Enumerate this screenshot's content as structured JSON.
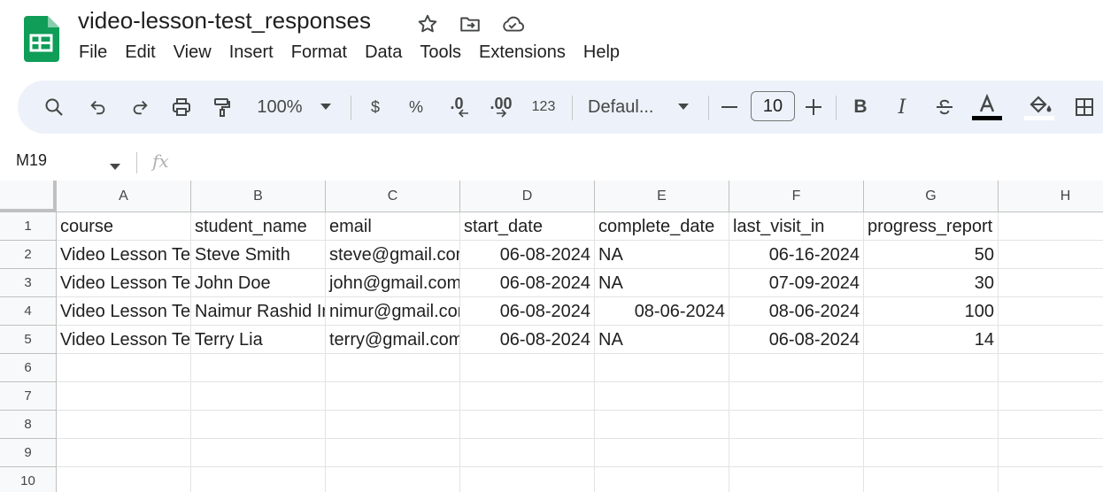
{
  "doc": {
    "title": "video-lesson-test_responses",
    "star_icon": "star-icon",
    "move_icon": "move-to-folder-icon",
    "cloud_icon": "cloud-saved-icon",
    "brand_color": "#0f9d58"
  },
  "menu": [
    "File",
    "Edit",
    "View",
    "Insert",
    "Format",
    "Data",
    "Tools",
    "Extensions",
    "Help"
  ],
  "toolbar": {
    "zoom": "100%",
    "currency": "$",
    "percent": "%",
    "decrease_decimal": ".0",
    "increase_decimal": ".00",
    "number_format": "123",
    "font": "Defaul...",
    "font_size": "10",
    "bold": "B",
    "italic": "I",
    "text_color_bar": "#000000"
  },
  "formula_bar": {
    "cell_ref": "M19",
    "fx": "fx"
  },
  "sheet": {
    "columns": [
      "A",
      "B",
      "C",
      "D",
      "E",
      "F",
      "G",
      "H"
    ],
    "row_numbers": [
      "1",
      "2",
      "3",
      "4",
      "5",
      "6",
      "7",
      "8",
      "9",
      "10"
    ],
    "header_row": [
      "course",
      "student_name",
      "email",
      "start_date",
      "complete_date",
      "last_visit_in",
      "progress_report"
    ],
    "rows": [
      [
        "Video Lesson Test",
        "Steve Smith",
        "steve@gmail.com",
        "06-08-2024",
        "NA",
        "06-16-2024",
        "50"
      ],
      [
        "Video Lesson Test",
        "John Doe",
        "john@gmail.com",
        "06-08-2024",
        "NA",
        "07-09-2024",
        "30"
      ],
      [
        "Video Lesson Test",
        "Naimur Rashid Imon",
        "nimur@gmail.com",
        "06-08-2024",
        "08-06-2024",
        "08-06-2024",
        "100"
      ],
      [
        "Video Lesson Test",
        "Terry Lia",
        "terry@gmail.com",
        "06-08-2024",
        "NA",
        "06-08-2024",
        "14"
      ]
    ]
  }
}
